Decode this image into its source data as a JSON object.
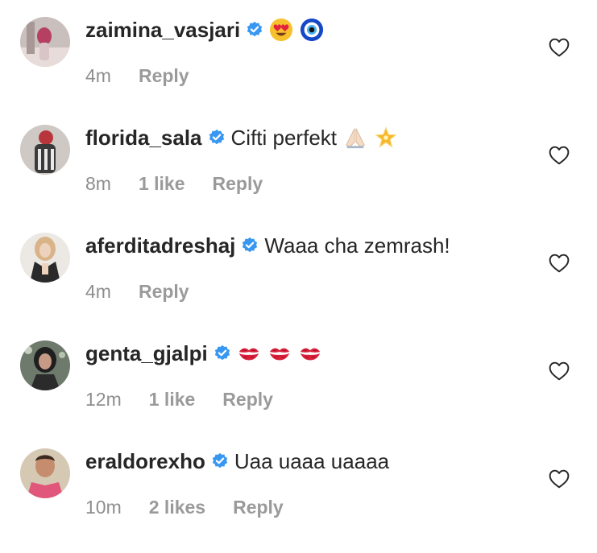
{
  "comments": [
    {
      "username": "zaimina_vasjari",
      "text": "",
      "emojis": [
        "heart-eyes-emoji",
        "evil-eye-emoji"
      ],
      "time": "4m",
      "likes": "",
      "reply": "Reply",
      "avatar_colors": [
        "#b7a7a3",
        "#e7dcd9",
        "#b54062"
      ]
    },
    {
      "username": "florida_sala",
      "text": "Cifti perfekt",
      "emojis": [
        "praying-hands-emoji",
        "glowing-star-emoji"
      ],
      "time": "8m",
      "likes": "1 like",
      "reply": "Reply",
      "avatar_colors": [
        "#c9c3bf",
        "#3b3b3b",
        "#b8363b"
      ]
    },
    {
      "username": "aferditadreshaj",
      "text": "Waaa cha zemrash!",
      "emojis": [],
      "time": "4m",
      "likes": "",
      "reply": "Reply",
      "avatar_colors": [
        "#e9e4df",
        "#d9b489",
        "#2a2a2a"
      ]
    },
    {
      "username": "genta_gjalpi",
      "text": "",
      "emojis": [
        "kiss-mark-emoji",
        "kiss-mark-emoji",
        "kiss-mark-emoji"
      ],
      "time": "12m",
      "likes": "1 like",
      "reply": "Reply",
      "avatar_colors": [
        "#6e7a6b",
        "#c79a86",
        "#1f1f1f"
      ]
    },
    {
      "username": "eraldorexho",
      "text": "Uaa uaaa uaaaa",
      "emojis": [],
      "time": "10m",
      "likes": "2 likes",
      "reply": "Reply",
      "avatar_colors": [
        "#d6c9b4",
        "#c58d6e",
        "#e1577b"
      ]
    }
  ],
  "colors": {
    "verified_blue": "#3897f0",
    "meta_gray": "#8e8e8e",
    "text_dark": "#262626"
  },
  "icons": {
    "verified": "verified-badge-icon",
    "like": "heart-outline-icon"
  }
}
